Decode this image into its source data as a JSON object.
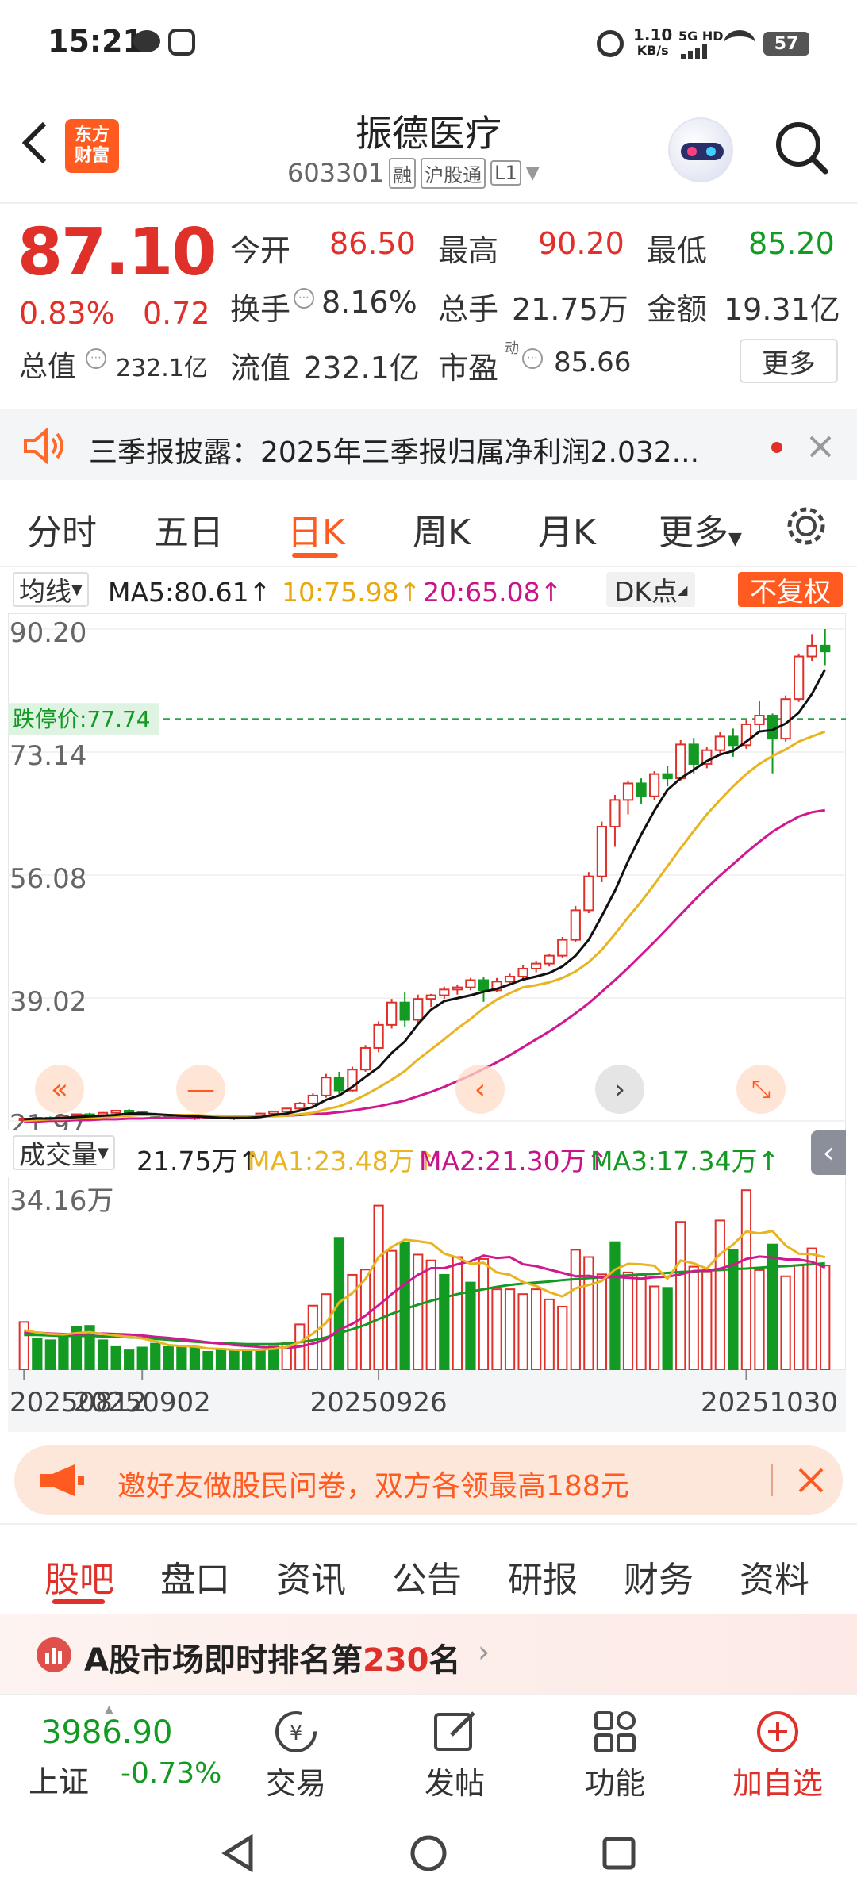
{
  "status": {
    "time": "15:21",
    "net_speed_value": "1.10",
    "net_speed_unit": "KB/s",
    "net_type": "5G HD",
    "battery": "57"
  },
  "header": {
    "logo_line1": "东方",
    "logo_line2": "财富",
    "title": "振德医疗",
    "code": "603301",
    "badge_rong": "融",
    "badge_hgt": "沪股通",
    "badge_l1": "L1"
  },
  "quote": {
    "price": "87.10",
    "change_pct": "0.83%",
    "change_abs": "0.72",
    "open_label": "今开",
    "open": "86.50",
    "high_label": "最高",
    "high": "90.20",
    "low_label": "最低",
    "low": "85.20",
    "turnover_label": "换手",
    "turnover": "8.16%",
    "volume_label": "总手",
    "volume": "21.75万",
    "amount_label": "金额",
    "amount": "19.31亿",
    "mktcap_label": "总值",
    "mktcap": "232.1亿",
    "float_label": "流值",
    "float": "232.1亿",
    "pe_label": "市盈",
    "pe_sup": "动",
    "pe": "85.66",
    "more": "更多"
  },
  "news": {
    "text": "三季报披露：2025年三季报归属净利润2.032..."
  },
  "chart_tabs": [
    "分时",
    "五日",
    "日K",
    "周K",
    "月K",
    "更多"
  ],
  "indicator": {
    "ma_select": "均线",
    "ma5": "MA5:80.61",
    "ma10": "10:75.98",
    "ma20": "20:65.08",
    "arrow": "↑",
    "dk": "DK点",
    "fq": "不复权"
  },
  "chart_data": {
    "type": "candlestick",
    "y_ticks": [
      "90.20",
      "73.14",
      "56.08",
      "39.02",
      "21.97"
    ],
    "limit_down_label": "跌停价:77.74",
    "ylim": [
      21.97,
      90.2
    ],
    "candles": [
      [
        22.1,
        22.4,
        22.0,
        22.3
      ],
      [
        22.3,
        22.5,
        22.1,
        22.4
      ],
      [
        22.4,
        22.6,
        22.2,
        22.3
      ],
      [
        22.3,
        22.8,
        22.2,
        22.7
      ],
      [
        22.7,
        23.0,
        22.5,
        22.9
      ],
      [
        22.9,
        23.1,
        22.6,
        22.8
      ],
      [
        22.8,
        23.2,
        22.6,
        23.1
      ],
      [
        23.1,
        23.5,
        22.9,
        23.4
      ],
      [
        23.4,
        23.6,
        23.0,
        23.2
      ],
      [
        23.2,
        23.3,
        22.8,
        22.9
      ],
      [
        22.9,
        23.1,
        22.6,
        22.7
      ],
      [
        22.7,
        22.9,
        22.4,
        22.5
      ],
      [
        22.5,
        22.7,
        22.2,
        22.3
      ],
      [
        22.3,
        22.6,
        22.1,
        22.5
      ],
      [
        22.5,
        22.8,
        22.3,
        22.6
      ],
      [
        22.6,
        22.8,
        22.2,
        22.3
      ],
      [
        22.3,
        22.6,
        22.1,
        22.5
      ],
      [
        22.5,
        22.7,
        22.3,
        22.6
      ],
      [
        22.6,
        23.1,
        22.4,
        23.0
      ],
      [
        23.0,
        23.4,
        22.8,
        23.3
      ],
      [
        23.3,
        23.8,
        23.1,
        23.7
      ],
      [
        23.7,
        24.6,
        23.5,
        24.4
      ],
      [
        24.4,
        25.8,
        24.1,
        25.5
      ],
      [
        25.5,
        28.5,
        25.2,
        28.0
      ],
      [
        28.0,
        28.8,
        25.5,
        26.2
      ],
      [
        26.2,
        29.5,
        26.0,
        29.1
      ],
      [
        29.1,
        32.5,
        28.8,
        32.1
      ],
      [
        32.1,
        35.8,
        31.5,
        35.3
      ],
      [
        35.3,
        38.9,
        34.8,
        38.4
      ],
      [
        38.4,
        39.8,
        35.0,
        36.0
      ],
      [
        36.0,
        39.5,
        35.5,
        38.9
      ],
      [
        38.9,
        39.6,
        37.8,
        39.4
      ],
      [
        39.4,
        40.6,
        38.9,
        40.2
      ],
      [
        40.2,
        40.9,
        39.5,
        40.5
      ],
      [
        40.5,
        41.8,
        40.1,
        41.5
      ],
      [
        41.5,
        42.0,
        38.5,
        40.1
      ],
      [
        40.1,
        41.8,
        39.8,
        41.3
      ],
      [
        41.3,
        42.4,
        40.9,
        42.0
      ],
      [
        42.0,
        43.6,
        41.7,
        43.1
      ],
      [
        43.1,
        44.2,
        42.6,
        43.8
      ],
      [
        43.8,
        45.2,
        43.4,
        44.9
      ],
      [
        44.9,
        47.5,
        44.6,
        47.1
      ],
      [
        47.1,
        51.8,
        46.8,
        51.2
      ],
      [
        51.2,
        56.5,
        50.8,
        55.9
      ],
      [
        55.9,
        63.5,
        55.1,
        62.8
      ],
      [
        62.8,
        67.2,
        60.0,
        66.5
      ],
      [
        66.5,
        69.2,
        64.5,
        68.8
      ],
      [
        68.8,
        69.5,
        66.0,
        67.0
      ],
      [
        67.0,
        70.5,
        66.5,
        70.1
      ],
      [
        70.1,
        71.2,
        68.4,
        69.5
      ],
      [
        69.5,
        74.8,
        69.2,
        74.2
      ],
      [
        74.2,
        75.1,
        70.2,
        71.5
      ],
      [
        71.5,
        73.8,
        70.9,
        73.4
      ],
      [
        73.4,
        75.9,
        72.8,
        75.3
      ],
      [
        75.3,
        76.4,
        72.5,
        74.1
      ],
      [
        74.1,
        77.6,
        73.6,
        77.0
      ],
      [
        77.0,
        80.2,
        76.1,
        78.2
      ],
      [
        78.2,
        78.5,
        70.2,
        75.0
      ],
      [
        75.0,
        81.0,
        74.6,
        80.5
      ],
      [
        80.5,
        86.8,
        80.1,
        86.4
      ],
      [
        86.4,
        89.5,
        85.8,
        87.9
      ],
      [
        87.9,
        90.2,
        85.2,
        87.1
      ]
    ],
    "ma5": [
      22.2,
      22.3,
      22.3,
      22.4,
      22.5,
      22.6,
      22.7,
      22.8,
      23.0,
      23.0,
      22.9,
      22.8,
      22.7,
      22.6,
      22.5,
      22.4,
      22.4,
      22.4,
      22.5,
      22.8,
      23.0,
      23.4,
      23.9,
      24.9,
      25.5,
      26.7,
      28.1,
      29.4,
      31.4,
      33.0,
      35.4,
      37.4,
      38.6,
      39.0,
      39.4,
      39.9,
      40.3,
      40.9,
      41.6,
      42.0,
      42.5,
      43.4,
      44.9,
      47.1,
      50.4,
      53.9,
      58.0,
      61.7,
      65.0,
      67.9,
      69.5,
      70.7,
      71.9,
      72.8,
      73.3,
      74.6,
      76.0,
      76.2,
      77.1,
      78.6,
      81.2,
      84.6
    ],
    "ma10": [
      22.0,
      22.1,
      22.2,
      22.2,
      22.3,
      22.4,
      22.5,
      22.6,
      22.7,
      22.8,
      22.8,
      22.8,
      22.8,
      22.8,
      22.7,
      22.7,
      22.6,
      22.6,
      22.6,
      22.6,
      22.7,
      22.9,
      23.1,
      23.6,
      24.0,
      24.7,
      25.6,
      26.6,
      27.7,
      28.9,
      30.5,
      31.9,
      33.3,
      34.8,
      36.1,
      37.6,
      38.8,
      39.7,
      40.5,
      40.8,
      41.2,
      41.8,
      42.7,
      44.0,
      45.7,
      47.9,
      50.2,
      52.4,
      54.8,
      57.3,
      59.8,
      62.2,
      64.5,
      66.5,
      68.4,
      70.1,
      71.5,
      72.6,
      73.5,
      74.6,
      75.3,
      75.98
    ],
    "ma20": [
      21.9,
      21.9,
      22.0,
      22.0,
      22.1,
      22.1,
      22.2,
      22.2,
      22.3,
      22.3,
      22.4,
      22.4,
      22.4,
      22.5,
      22.5,
      22.5,
      22.6,
      22.6,
      22.6,
      22.7,
      22.7,
      22.8,
      22.9,
      23.0,
      23.2,
      23.4,
      23.7,
      24.0,
      24.4,
      24.8,
      25.4,
      26.0,
      26.7,
      27.5,
      28.3,
      29.2,
      30.1,
      31.1,
      32.2,
      33.3,
      34.4,
      35.6,
      36.9,
      38.3,
      39.9,
      41.5,
      43.2,
      45.0,
      46.8,
      48.7,
      50.6,
      52.5,
      54.3,
      56.0,
      57.6,
      59.2,
      60.7,
      62.1,
      63.2,
      64.2,
      64.8,
      65.08
    ],
    "x_ticks": [
      "20250812",
      "20250902",
      "20250926",
      "20251030"
    ],
    "x_tick_index": [
      0,
      9,
      27,
      55
    ],
    "volume": {
      "ylabel_max": "34.16万",
      "ymax": 34.16,
      "values": [
        10,
        6.5,
        6.2,
        6.8,
        9.0,
        9.2,
        6.2,
        4.8,
        4.1,
        4.7,
        5.5,
        4.8,
        5.1,
        4.6,
        3.8,
        4.4,
        3.9,
        4.2,
        4.3,
        4.9,
        5.7,
        9.5,
        13.4,
        15.8,
        27.5,
        19.8,
        20.9,
        34.2,
        24.8,
        26.5,
        24.0,
        22.8,
        19.8,
        23.5,
        18.2,
        23.1,
        16.8,
        16.8,
        15.8,
        16.8,
        14.7,
        13.2,
        25.0,
        23.5,
        19.9,
        26.6,
        20.3,
        19.8,
        17.4,
        17.1,
        30.8,
        21.5,
        20.5,
        31.1,
        25.0,
        37.4,
        20.8,
        26.1,
        19.5,
        21.8,
        25.3,
        21.75
      ],
      "is_down": [
        false,
        true,
        true,
        true,
        true,
        true,
        true,
        true,
        true,
        true,
        true,
        true,
        true,
        true,
        true,
        true,
        true,
        true,
        true,
        true,
        false,
        false,
        false,
        false,
        true,
        false,
        false,
        false,
        false,
        true,
        false,
        false,
        true,
        false,
        true,
        false,
        false,
        false,
        false,
        false,
        false,
        false,
        false,
        false,
        false,
        true,
        false,
        false,
        false,
        true,
        false,
        false,
        false,
        false,
        true,
        false,
        false,
        true,
        false,
        false,
        false,
        false
      ],
      "ma1": [
        8.3,
        7.8,
        7.5,
        7.4,
        7.7,
        7.9,
        7.5,
        7.2,
        6.9,
        6.6,
        6.0,
        5.2,
        5.0,
        4.9,
        4.5,
        4.4,
        4.2,
        4.2,
        4.2,
        4.4,
        4.8,
        5.8,
        7.6,
        9.8,
        14.1,
        16.0,
        18.9,
        23.5,
        25.6,
        27.1,
        26.8,
        26.4,
        24.2,
        23.4,
        22.1,
        22.3,
        20.3,
        19.8,
        18.3,
        17.5,
        16.2,
        15.3,
        17.0,
        17.7,
        18.5,
        20.9,
        22.1,
        22.0,
        21.7,
        19.0,
        22.8,
        22.2,
        21.1,
        24.1,
        26.1,
        28.8,
        28.4,
        28.9,
        25.9,
        24.2,
        24.1,
        23.48
      ],
      "ma2": [
        7.8,
        7.8,
        7.6,
        7.5,
        7.5,
        7.6,
        7.6,
        7.5,
        7.4,
        7.2,
        6.9,
        6.7,
        6.4,
        6.1,
        5.8,
        5.5,
        5.2,
        5.0,
        4.8,
        4.7,
        4.6,
        4.9,
        5.5,
        6.4,
        8.4,
        9.6,
        11.3,
        13.5,
        15.8,
        17.9,
        19.8,
        21.2,
        21.2,
        22.0,
        22.6,
        23.8,
        23.3,
        23.5,
        22.0,
        21.6,
        20.9,
        20.2,
        19.5,
        19.6,
        19.2,
        19.4,
        19.2,
        19.0,
        19.3,
        19.4,
        19.9,
        20.6,
        20.7,
        21.1,
        21.9,
        23.1,
        23.6,
        23.4,
        23.0,
        23.0,
        22.5,
        21.3
      ],
      "ma3": [
        7.3,
        7.3,
        7.2,
        7.1,
        7.1,
        7.1,
        7.0,
        6.9,
        6.8,
        6.7,
        6.5,
        6.3,
        6.1,
        5.9,
        5.7,
        5.6,
        5.5,
        5.4,
        5.4,
        5.4,
        5.5,
        5.8,
        6.2,
        6.8,
        7.7,
        8.5,
        9.4,
        10.6,
        11.7,
        12.7,
        13.6,
        14.4,
        15.1,
        15.8,
        16.3,
        16.8,
        17.3,
        17.7,
        18.0,
        18.2,
        18.4,
        18.7,
        18.9,
        19.1,
        19.3,
        19.5,
        19.7,
        19.9,
        20.0,
        20.2,
        20.4,
        20.5,
        20.7,
        20.8,
        21.0,
        21.1,
        21.3,
        21.5,
        21.6,
        21.8,
        22.0,
        22.2
      ]
    }
  },
  "volume_bar": {
    "select": "成交量",
    "vol": "21.75万",
    "ma1": "MA1:23.48万",
    "ma2": "MA2:21.30万",
    "ma3": "MA3:17.34万",
    "arrow": "↑"
  },
  "promo": {
    "text": "邀好友做股民问卷，双方各领最高188元"
  },
  "content_tabs": [
    "股吧",
    "盘口",
    "资讯",
    "公告",
    "研报",
    "财务",
    "资料"
  ],
  "rank": {
    "prefix": "A股市场即时排名第",
    "num": "230",
    "suffix": "名"
  },
  "bottom": {
    "index_value": "3986.90",
    "index_name": "上证",
    "index_change": "-0.73%",
    "trade": "交易",
    "post": "发帖",
    "func": "功能",
    "add": "加自选"
  },
  "colors": {
    "up": "#e0302a",
    "down": "#139a22",
    "accent": "#ff5a1f",
    "ma5": "#111111",
    "ma10": "#e8b420",
    "ma20": "#d01890"
  }
}
